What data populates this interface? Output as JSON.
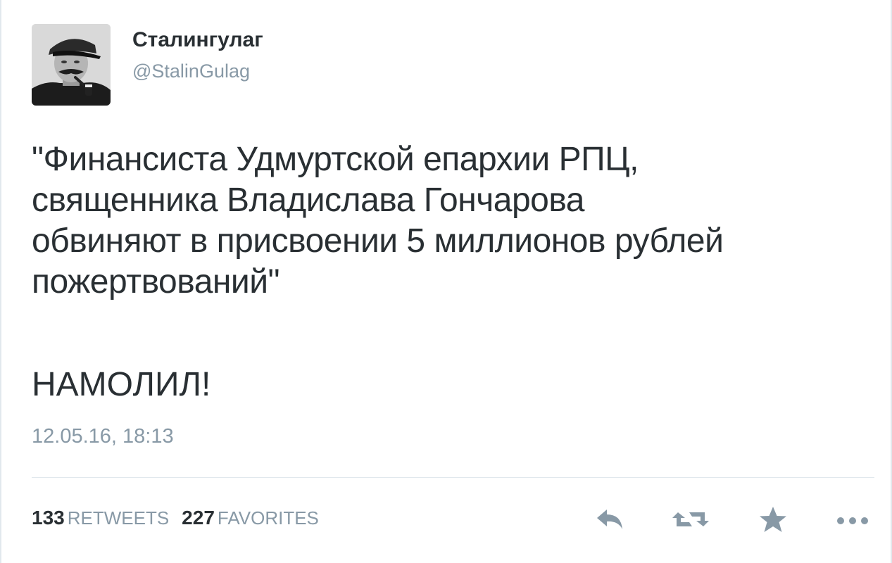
{
  "user": {
    "display_name": "Сталингулаг",
    "handle": "@StalinGulag"
  },
  "tweet": {
    "lines": [
      "\"Финансиста Удмуртской епархии РПЦ,",
      "священника Владислава Гончарова",
      "обвиняют в присвоении 5 миллионов рублей",
      "пожертвований\""
    ],
    "punchline": "НАМОЛИЛ!",
    "timestamp": "12.05.16, 18:13"
  },
  "stats": {
    "retweets_count": "133",
    "retweets_label": "RETWEETS",
    "favorites_count": "227",
    "favorites_label": "FAVORITES"
  },
  "actions": {
    "reply_icon": "reply-icon",
    "retweet_icon": "retweet-icon",
    "favorite_icon": "star-icon",
    "more_icon": "more-dots-icon"
  },
  "colors": {
    "text": "#292f33",
    "muted": "#8899a6",
    "divider": "#e1e8ed"
  }
}
